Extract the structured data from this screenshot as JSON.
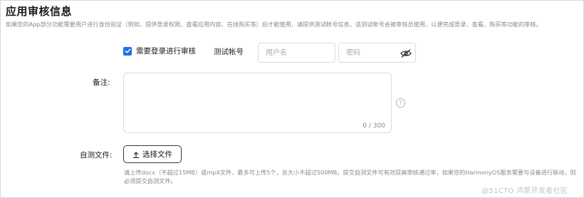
{
  "section": {
    "title": "应用审核信息",
    "description": "如果您的App部分功能需要用户进行身份验证（例如，提供登录权限、查看应用内容、在线购买等）后才能使用，请提供测试帐号信息，该测试帐号会被审核员使用，以便完成登录、查看、购买等功能的审核。"
  },
  "login_review": {
    "checkbox_label": "需要登录进行审核",
    "checked": true,
    "test_account_label": "测试帐号",
    "username_placeholder": "用户名",
    "password_placeholder": "密码",
    "password_toggle_icon": "eye-hidden-icon"
  },
  "remark": {
    "label": "备注:",
    "value": "",
    "counter": "0 / 300",
    "help_icon": "question-circle-icon"
  },
  "self_test": {
    "label": "自测文件:",
    "upload_button_label": "选择文件",
    "upload_icon": "upload-arrow-icon",
    "hint": "请上传docx（不超过15MB）或mp4文件，最多可上传5个，总大小不超过500MB。提交自测文件可有效提高审核通过率，如果您的HarmonyOS服务需要与设备进行联动，则必须提交自测文件。"
  },
  "colors": {
    "accent": "#1a73e8",
    "text": "#191919",
    "muted": "#8a8a8a"
  },
  "watermark": "@51CTO 鸿蒙开发者社区"
}
